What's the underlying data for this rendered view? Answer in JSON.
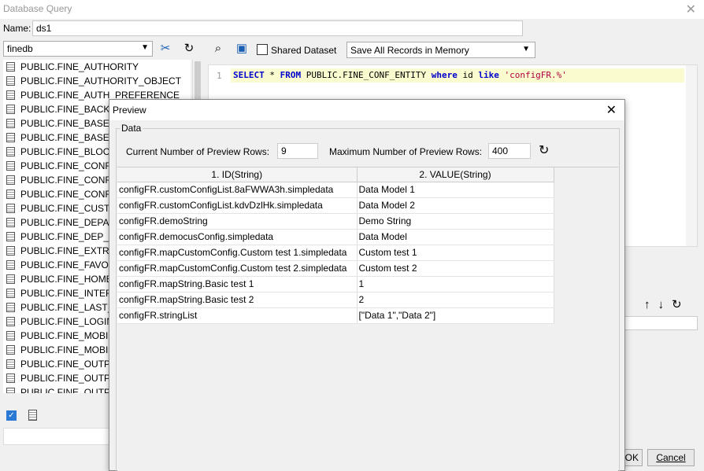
{
  "window": {
    "title": "Database Query"
  },
  "name_field": {
    "label": "Name:",
    "value": "ds1"
  },
  "left": {
    "db_selected": "finedb",
    "tables": [
      "PUBLIC.FINE_AUTHORITY",
      "PUBLIC.FINE_AUTHORITY_OBJECT",
      "PUBLIC.FINE_AUTH_PREFERENCE",
      "PUBLIC.FINE_BACKU",
      "PUBLIC.FINE_BASE_",
      "PUBLIC.FINE_BASE_",
      "PUBLIC.FINE_BLOCK",
      "PUBLIC.FINE_CONF_",
      "PUBLIC.FINE_CONF_",
      "PUBLIC.FINE_CONF_",
      "PUBLIC.FINE_CUSTO",
      "PUBLIC.FINE_DEPAR",
      "PUBLIC.FINE_DEP_R",
      "PUBLIC.FINE_EXTRA",
      "PUBLIC.FINE_FAVOR",
      "PUBLIC.FINE_HOMEP",
      "PUBLIC.FINE_INTERN",
      "PUBLIC.FINE_LAST_",
      "PUBLIC.FINE_LOGIN_",
      "PUBLIC.FINE_MOBILI",
      "PUBLIC.FINE_MOBILE",
      "PUBLIC.FINE_OUTPU",
      "PUBLIC.FINE_OUTPU",
      "PUBLIC.FINE_OUTPU"
    ]
  },
  "right": {
    "shared_label": "Shared Dataset",
    "save_mode": "Save All Records in Memory",
    "sql": {
      "line_no": "1",
      "kw_select": "SELECT",
      "star": " * ",
      "kw_from": "FROM",
      "table": " PUBLIC.FINE_CONF_ENTITY ",
      "kw_where": "where",
      "col": " id ",
      "kw_like": "like",
      "literal": " 'configFR.%'"
    }
  },
  "buttons": {
    "ok": "OK",
    "cancel": "Cancel"
  },
  "preview": {
    "title": "Preview",
    "group_label": "Data",
    "current_rows_label": "Current Number of Preview Rows:",
    "current_rows_value": "9",
    "max_rows_label": "Maximum Number of Preview Rows:",
    "max_rows_value": "400",
    "columns": [
      "1. ID(String)",
      "2. VALUE(String)"
    ],
    "rows": [
      [
        "configFR.customConfigList.8aFWWA3h.simpledata",
        "Data Model 1"
      ],
      [
        "configFR.customConfigList.kdvDzlHk.simpledata",
        "Data Model 2"
      ],
      [
        "configFR.demoString",
        "Demo String"
      ],
      [
        "configFR.democusConfig.simpledata",
        "Data Model"
      ],
      [
        "configFR.mapCustomConfig.Custom test 1.simpledata",
        "Custom test 1"
      ],
      [
        "configFR.mapCustomConfig.Custom test 2.simpledata",
        "Custom test 2"
      ],
      [
        "configFR.mapString.Basic test 1",
        "1"
      ],
      [
        "configFR.mapString.Basic test 2",
        "2"
      ],
      [
        "configFR.stringList",
        "[\"Data 1\",\"Data 2\"]"
      ]
    ]
  }
}
